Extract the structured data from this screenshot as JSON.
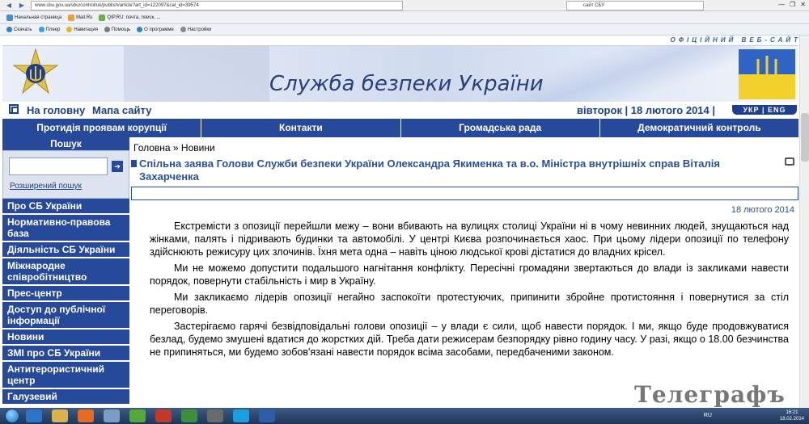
{
  "browser": {
    "url": "www.sbu.gov.ua/sbu/control/uk/publish/article?art_id=122097&cat_id=39574",
    "search_value": "сайт СБУ",
    "bookmarks": [
      "Начальная страница",
      "Mail.Ru",
      "QIP.RU: почта, поиск, ..."
    ],
    "toolbar_items": [
      "Скачать",
      "Плеер",
      "Навигация",
      "Помощь",
      "О программе",
      "Настройки"
    ]
  },
  "header": {
    "official": "ОФІЦІЙНИЙ ВЕБ-САЙТ",
    "site_title": "Служба безпеки України",
    "home_link": "На головну",
    "map_link": "Мапа сайту",
    "date": "вівторок | 18 лютого 2014 |",
    "lang": "УКР | ENG"
  },
  "menu": [
    "Протидія проявам корупції",
    "Контакти",
    "Громадська рада",
    "Демократичний контроль"
  ],
  "sidebar": {
    "search_title": "Пошук",
    "search_value": "",
    "search_go": "➔",
    "advanced": "Розширений пошук",
    "items": [
      "Про СБ України",
      "Нормативно-правова база",
      "Діяльність СБ України",
      "Міжнародне співробітництво",
      "Прес-центр",
      "Доступ до публічної інформації",
      "Новини",
      "ЗМІ про СБ України",
      "Антитерористичний центр",
      "Галузевий"
    ]
  },
  "article": {
    "breadcrumb": "Головна »  Новини",
    "title": "Спільна заява Голови Служби безпеки України Олександра Якименка та в.о. Міністра внутрішніх справ Віталія Захарченка",
    "date": "18 лютого 2014",
    "paragraphs": [
      "Екстремісти з опозиції перейшли межу – вони вбивають на вулицях столиці України ні в чому невинних людей, знущаються над жінками, палять і підривають будинки та автомобілі. У центрі Києва розпочинається хаос. При цьому лідери опозиції по телефону здійснюють режисуру цих злочинів. Їхня мета одна – навіть ціною людської крові дістатися до владних крісел.",
      "Ми не можемо допустити подальшого нагнітання конфлікту. Пересічні громадяни звертаються до влади із закликами навести порядок, повернути стабільність і мир в Україну.",
      "Ми закликаємо лідерів опозиції негайно заспокоїти протестуючих, припинити збройне протистояння і повернутися за стіл переговорів.",
      "Застерігаємо гарячі безвідповідальні голови опозиції – у влади є сили, щоб навести порядок. І ми, якщо буде продовжуватися безлад, будемо змушені вдатися до жорстких дій. Треба дати режисерам безпорядку рівно годину часу. У разі, якщо о 18.00 безчинства не припиняться, ми будемо зобов'язані навести порядок всіма засобами, передбаченими законом."
    ]
  },
  "watermark": "Телеграфъ",
  "taskbar": {
    "lang": "RU",
    "time": "16:21",
    "date": "18.02.2014"
  },
  "colors": {
    "brand": "#26499a",
    "link": "#1d3f8c",
    "title": "#2a4f9c"
  }
}
